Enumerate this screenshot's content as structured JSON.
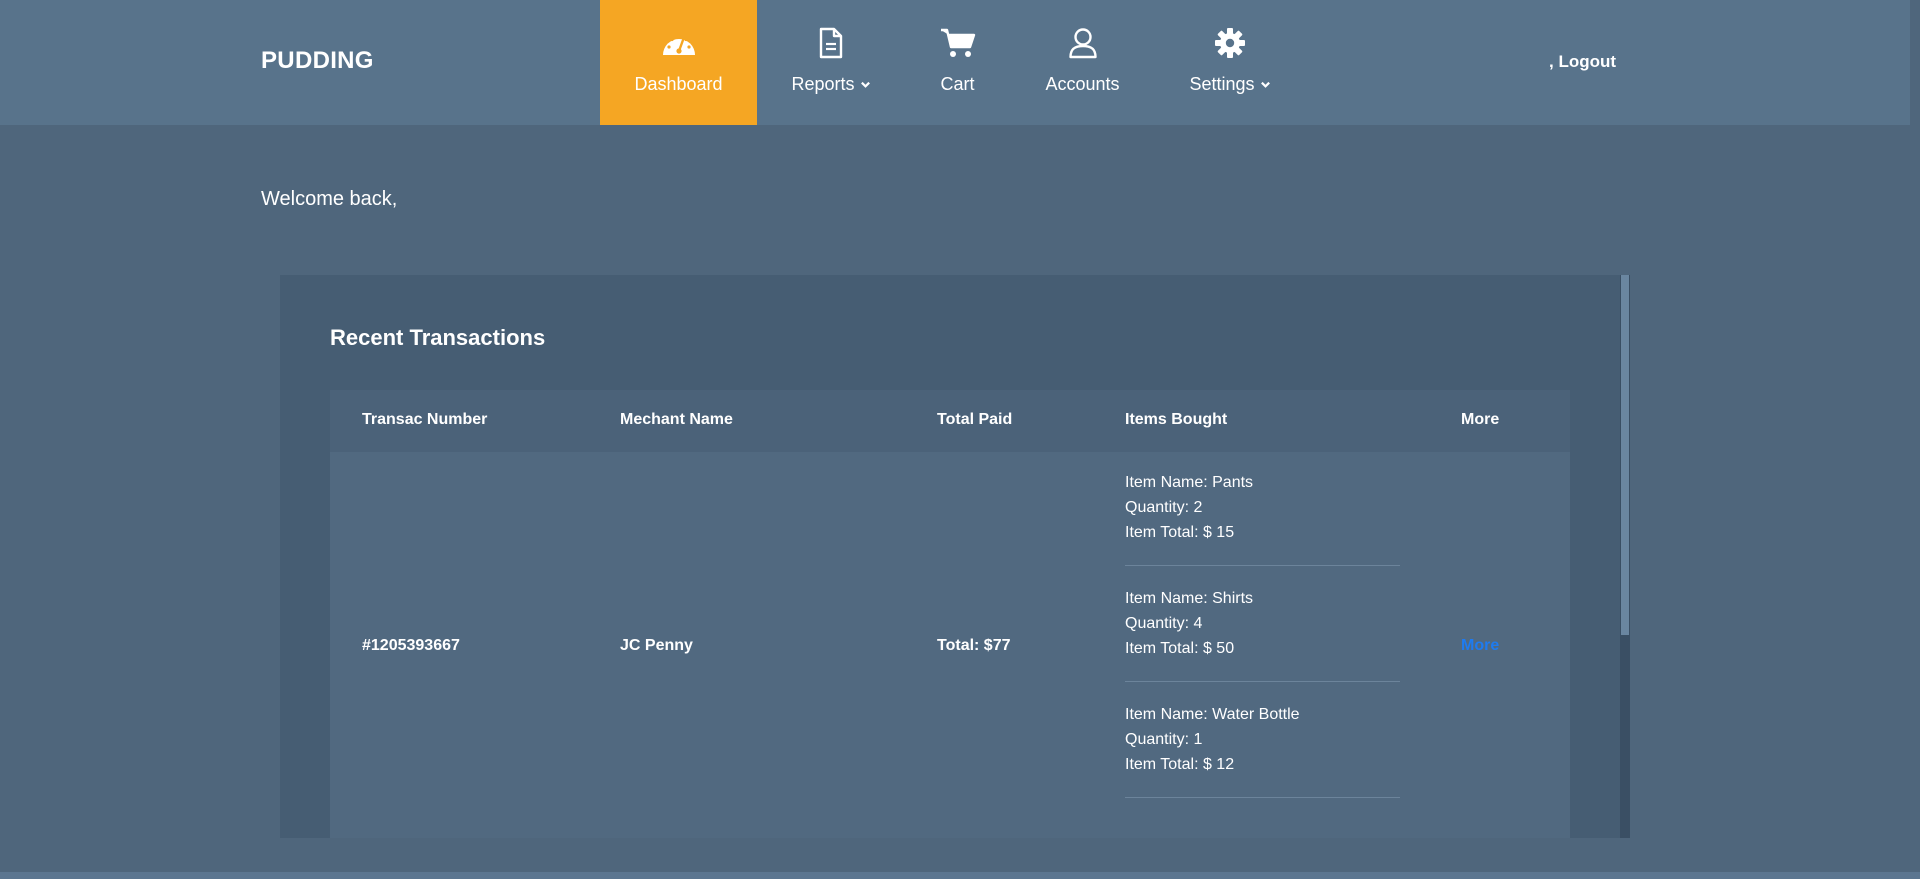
{
  "brand": "PUDDING",
  "nav": {
    "items": [
      {
        "label": "Dashboard",
        "icon": "dashboard-gauge-icon"
      },
      {
        "label": "Reports",
        "icon": "file-icon"
      },
      {
        "label": "Cart",
        "icon": "cart-icon"
      },
      {
        "label": "Accounts",
        "icon": "user-icon"
      },
      {
        "label": "Settings",
        "icon": "gear-icon"
      }
    ],
    "logout": ", Logout"
  },
  "welcome": "Welcome back,",
  "transactions": {
    "title": "Recent Transactions",
    "headers": [
      "Transac Number",
      "Mechant Name",
      "Total Paid",
      "Items Bought",
      "More"
    ],
    "rows": [
      {
        "number": "#1205393667",
        "merchant": "JC Penny",
        "total": "Total: $77",
        "items": [
          {
            "name": "Item Name: Pants",
            "qty": "Quantity: 2",
            "total": "Item Total: $ 15"
          },
          {
            "name": "Item Name: Shirts",
            "qty": "Quantity: 4",
            "total": "Item Total: $ 50"
          },
          {
            "name": "Item Name: Water Bottle",
            "qty": "Quantity: 1",
            "total": "Item Total: $ 12"
          }
        ],
        "more": "More"
      }
    ]
  },
  "colors": {
    "accent": "#f5a623",
    "link": "#1e7bf0",
    "navbar": "#58738b",
    "background": "#4f667c"
  }
}
